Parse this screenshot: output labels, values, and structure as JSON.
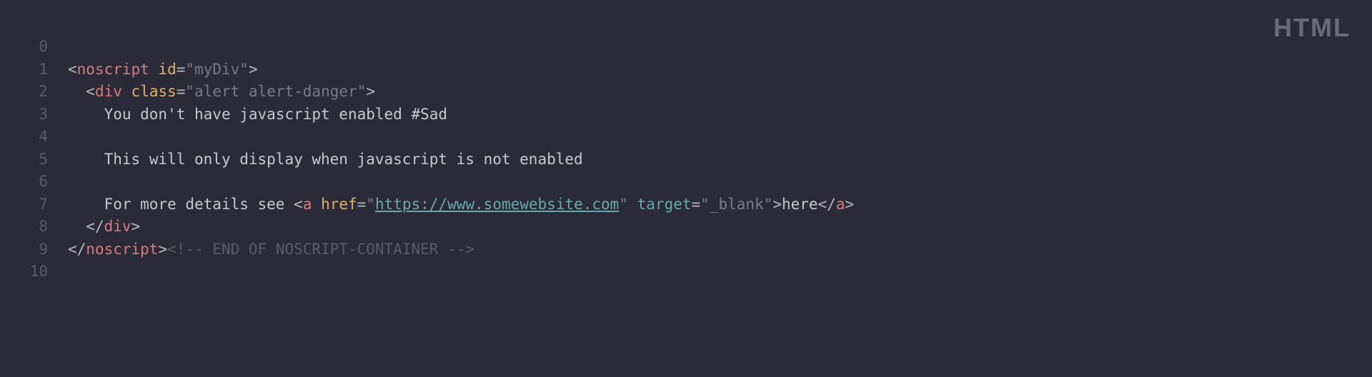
{
  "language_badge": "HTML",
  "gutter": [
    "0",
    "1",
    "2",
    "3",
    "4",
    "5",
    "6",
    "7",
    "8",
    "9",
    "10"
  ],
  "code": {
    "l0": "",
    "l1": {
      "open": "<",
      "tag": "noscript",
      "sp": " ",
      "attr": "id",
      "eq": "=",
      "q1": "\"",
      "val": "myDiv",
      "q2": "\"",
      "close": ">"
    },
    "l2": {
      "indent": "  ",
      "open": "<",
      "tag": "div",
      "sp": " ",
      "attr": "class",
      "eq": "=",
      "q1": "\"",
      "val": "alert alert-danger",
      "q2": "\"",
      "close": ">"
    },
    "l3": {
      "indent": "    ",
      "text": "You don't have javascript enabled #Sad"
    },
    "l4": "",
    "l5": {
      "indent": "    ",
      "text": "This will only display when javascript is not enabled"
    },
    "l6": "",
    "l7": {
      "indent": "    ",
      "text1": "For more details see ",
      "open": "<",
      "tag": "a",
      "sp1": " ",
      "hrefAttr": "href",
      "eq1": "=",
      "q1": "\"",
      "url": "https://www.somewebsite.com",
      "q2": "\"",
      "sp2": " ",
      "targetAttr": "target",
      "eq2": "=",
      "q3": "\"",
      "targetVal": "_blank",
      "q4": "\"",
      "close1": ">",
      "linkText": "here",
      "open2": "</",
      "tag2": "a",
      "close2": ">"
    },
    "l8": {
      "indent": "  ",
      "open": "</",
      "tag": "div",
      "close": ">"
    },
    "l9": {
      "open": "</",
      "tag": "noscript",
      "close": ">",
      "comment": "<!-- END OF NOSCRIPT-CONTAINER -->"
    },
    "l10": ""
  }
}
